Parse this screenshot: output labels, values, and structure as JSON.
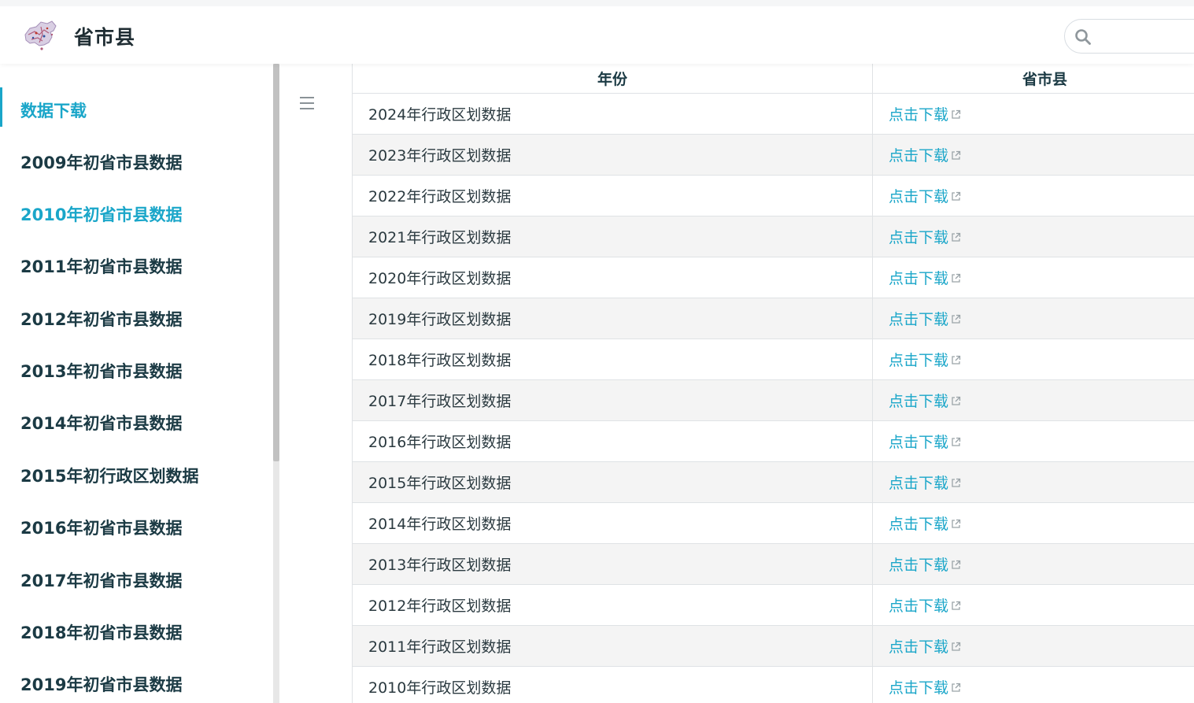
{
  "header": {
    "site_title": "省市县",
    "search": {
      "placeholder": "",
      "value": ""
    }
  },
  "sidebar": {
    "items": [
      {
        "label": "数据下载",
        "active": true
      },
      {
        "label": "2009年初省市县数据",
        "active": false
      },
      {
        "label": "2010年初省市县数据",
        "active": false,
        "highlight": true
      },
      {
        "label": "2011年初省市县数据",
        "active": false
      },
      {
        "label": "2012年初省市县数据",
        "active": false
      },
      {
        "label": "2013年初省市县数据",
        "active": false
      },
      {
        "label": "2014年初省市县数据",
        "active": false
      },
      {
        "label": "2015年初行政区划数据",
        "active": false
      },
      {
        "label": "2016年初省市县数据",
        "active": false
      },
      {
        "label": "2017年初省市县数据",
        "active": false
      },
      {
        "label": "2018年初省市县数据",
        "active": false
      },
      {
        "label": "2019年初省市县数据",
        "active": false
      }
    ]
  },
  "table": {
    "headers": [
      "年份",
      "省市县"
    ],
    "rows": [
      {
        "year": "2024年行政区划数据",
        "link": "点击下载"
      },
      {
        "year": "2023年行政区划数据",
        "link": "点击下载"
      },
      {
        "year": "2022年行政区划数据",
        "link": "点击下载"
      },
      {
        "year": "2021年行政区划数据",
        "link": "点击下载"
      },
      {
        "year": "2020年行政区划数据",
        "link": "点击下载"
      },
      {
        "year": "2019年行政区划数据",
        "link": "点击下载"
      },
      {
        "year": "2018年行政区划数据",
        "link": "点击下载"
      },
      {
        "year": "2017年行政区划数据",
        "link": "点击下载"
      },
      {
        "year": "2016年行政区划数据",
        "link": "点击下载"
      },
      {
        "year": "2015年行政区划数据",
        "link": "点击下载"
      },
      {
        "year": "2014年行政区划数据",
        "link": "点击下载"
      },
      {
        "year": "2013年行政区划数据",
        "link": "点击下载"
      },
      {
        "year": "2012年行政区划数据",
        "link": "点击下载"
      },
      {
        "year": "2011年行政区划数据",
        "link": "点击下载"
      },
      {
        "year": "2010年行政区划数据",
        "link": "点击下载"
      }
    ]
  },
  "icons": {
    "logo": "china-map-logo-icon",
    "search": "search-icon",
    "menu": "hamburger-menu-icon",
    "external": "external-link-icon"
  },
  "colors": {
    "accent": "#1aa6c9",
    "text": "#1b3a44",
    "row_alt": "#f4f4f4"
  }
}
